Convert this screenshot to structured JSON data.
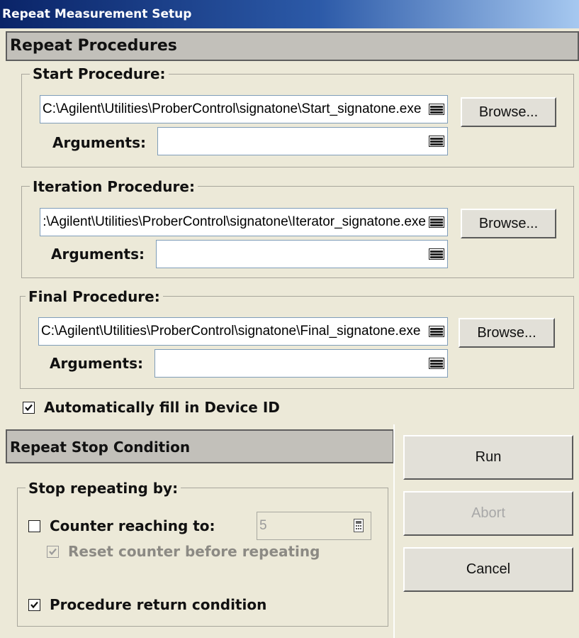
{
  "window": {
    "title": "Repeat Measurement Setup"
  },
  "repeat_procedures": {
    "header": "Repeat Procedures",
    "start": {
      "legend": "Start Procedure:",
      "path": "C:\\Agilent\\Utilities\\ProberControl\\signatone\\Start_signatone.exe",
      "arguments_label": "Arguments:",
      "arguments_value": "",
      "browse_label": "Browse..."
    },
    "iteration": {
      "legend": "Iteration Procedure:",
      "path": "C:\\Agilent\\Utilities\\ProberControl\\signatone\\Iterator_signatone.exe",
      "arguments_label": "Arguments:",
      "arguments_value": "",
      "browse_label": "Browse..."
    },
    "final": {
      "legend": "Final Procedure:",
      "path": "C:\\Agilent\\Utilities\\ProberControl\\signatone\\Final_signatone.exe",
      "arguments_label": "Arguments:",
      "arguments_value": "",
      "browse_label": "Browse..."
    },
    "auto_fill": {
      "label": "Automatically fill in Device ID",
      "checked": true
    }
  },
  "stop_condition": {
    "header": "Repeat Stop Condition",
    "legend": "Stop repeating by:",
    "counter": {
      "label": "Counter reaching to:",
      "checked": false,
      "value": "5"
    },
    "reset_counter": {
      "label": "Reset counter before repeating",
      "checked": true,
      "enabled": false
    },
    "procedure_return": {
      "label": "Procedure return condition",
      "checked": true
    }
  },
  "buttons": {
    "run": "Run",
    "abort": "Abort",
    "cancel": "Cancel"
  }
}
